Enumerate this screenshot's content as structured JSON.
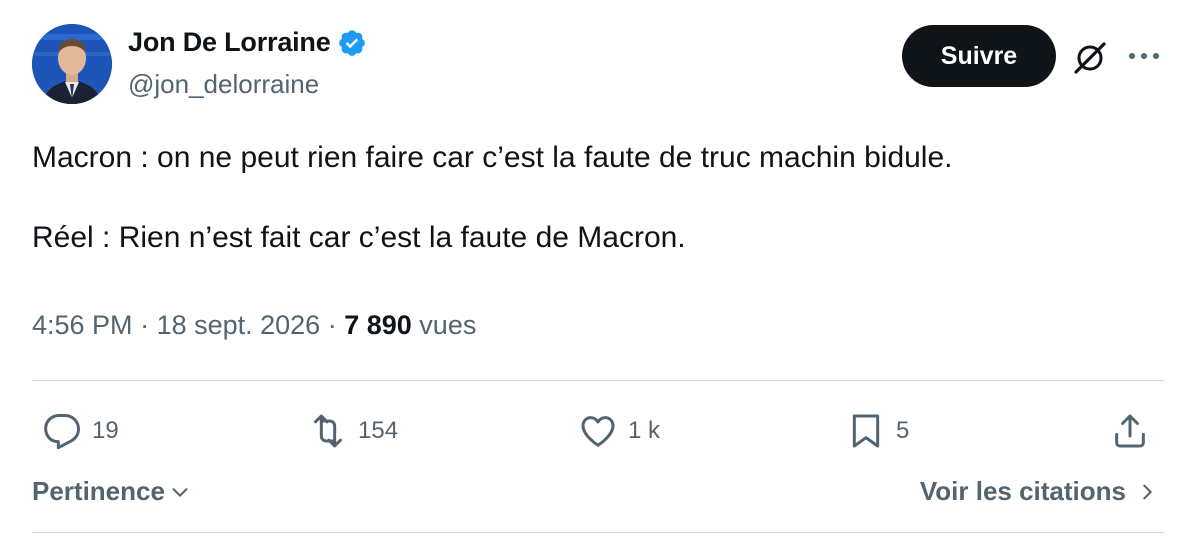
{
  "author": {
    "name": "Jon De Lorraine",
    "handle": "@jon_delorraine",
    "verified": true,
    "avatar": "avatar-photo"
  },
  "header": {
    "follow_label": "Suivre",
    "grok_icon": "grok-icon",
    "more_icon": "more-icon"
  },
  "tweet": {
    "lines": [
      "Macron : on ne peut rien faire car c’est la faute de truc machin bidule.",
      "Réel : Rien n’est fait car c’est la faute de Macron."
    ]
  },
  "meta": {
    "time": "4:56 PM",
    "date": "18 sept. 2026",
    "views_count": "7 890",
    "views_label": "vues",
    "separator": " · "
  },
  "actions": {
    "replies": "19",
    "retweets": "154",
    "likes": "1 k",
    "bookmarks": "5"
  },
  "footer": {
    "sort_label": "Pertinence",
    "quotes_label": "Voir les citations"
  },
  "colors": {
    "text": "#0f1419",
    "muted": "#536471",
    "verified": "#1d9bf0",
    "follow_bg": "#0f1419",
    "divider": "#cfd9de"
  }
}
